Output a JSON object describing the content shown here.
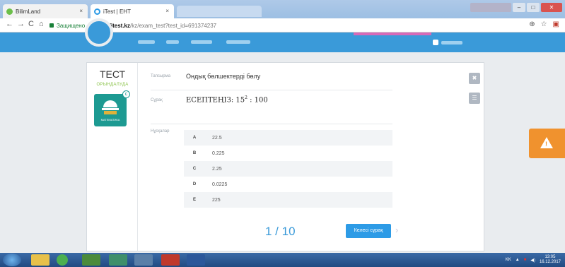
{
  "browser": {
    "tabs": [
      {
        "label": "BilimLand",
        "close": "×"
      },
      {
        "label": "iTest | ЕНТ",
        "close": "×"
      }
    ],
    "nav": {
      "back": "←",
      "forward": "→",
      "reload": "C",
      "home": "⌂"
    },
    "address": {
      "secure_label": "Защищено",
      "host": "https://itest.kz",
      "path": "/kz/exam_test?test_id=691374237"
    },
    "icons": {
      "zoom": "⊕",
      "star": "☆",
      "ext": "▣"
    }
  },
  "test": {
    "title": "ТЕСТ",
    "status": "ОРЫНДАЛУДА",
    "subject_label": "МАТЕМАТИКА",
    "badge": "c",
    "task_label": "Тапсырма",
    "task_text": "Ондық бөлшектерді бөлу",
    "question_label": "Сұрақ",
    "question_prefix": "ЕСЕПТЕҢІЗ: 15",
    "question_exp": "2",
    "question_suffix": " : 100",
    "answers_label": "Нұсқалар",
    "answers": [
      {
        "letter": "A",
        "value": "22.5"
      },
      {
        "letter": "B",
        "value": "0.225"
      },
      {
        "letter": "C",
        "value": "2.25"
      },
      {
        "letter": "D",
        "value": "0.0225"
      },
      {
        "letter": "E",
        "value": "225"
      }
    ],
    "pager": "1 / 10",
    "next_label": "Келесі сұрақ",
    "next_chevron": "›",
    "close_icon": "✖",
    "list_icon": "☰"
  },
  "warning": {
    "icon": "!"
  },
  "taskbar": {
    "lang": "KK",
    "time": "13:05",
    "date": "16.12.2017"
  }
}
